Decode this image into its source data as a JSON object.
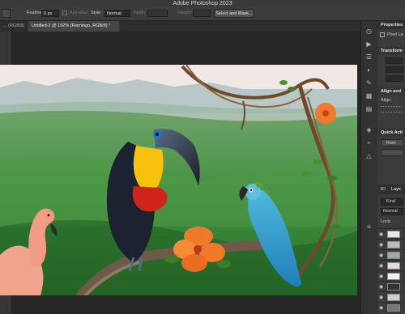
{
  "app": {
    "title": "Adobe Photoshop 2023"
  },
  "options_bar": {
    "feather_label": "Feather:",
    "feather_value": "0 px",
    "anti_alias_label": "Anti-alias",
    "style_label": "Style:",
    "style_value": "Normal",
    "width_label": "Width:",
    "height_label": "Height:",
    "select_mask_label": "Select and Mask..."
  },
  "tabs": [
    {
      "label": "... (RGB/8)",
      "active": false
    },
    {
      "label": "Untitled-2 @ 192% (Flamingo, RGB/8) *",
      "active": true
    }
  ],
  "right_panel": {
    "properties_label": "Properties",
    "pixel_layer_label": "Pixel La",
    "transform_label": "Transform",
    "align_label": "Align and",
    "align_sub": "Align:",
    "quick_actions_label": "Quick Acti",
    "remove_label": "Rem",
    "tab_3d": "3D",
    "tab_layers": "Laye",
    "kind_label": "Kind",
    "blend_mode": "Normal",
    "lock_label": "Lock:"
  },
  "colors": {
    "chrome": "#2b2b2b",
    "panel": "#3b3b3b",
    "accent": "#4a90e2"
  },
  "icons": [
    "move-icon",
    "marquee-icon",
    "history-icon",
    "properties-icon",
    "brush-icon",
    "layers-icon",
    "eye-icon",
    "close-icon"
  ]
}
